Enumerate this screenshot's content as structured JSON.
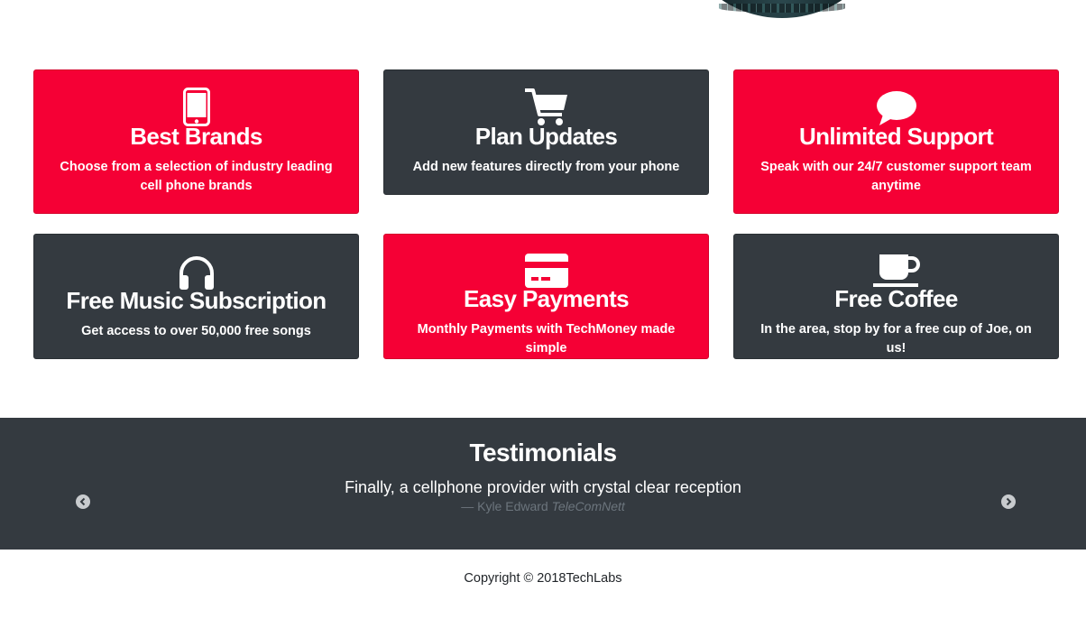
{
  "features": [
    {
      "title": "Best Brands",
      "desc": "Choose from a selection of industry leading cell phone brands",
      "icon": "mobile-phone-icon",
      "color": "#f50035"
    },
    {
      "title": "Plan Updates",
      "desc": "Add new features directly from your phone",
      "icon": "shopping-cart-icon",
      "color": "#343a40"
    },
    {
      "title": "Unlimited Support",
      "desc": "Speak with our 24/7 customer support team anytime",
      "icon": "comment-icon",
      "color": "#f50035"
    },
    {
      "title": "Free Music Subscription",
      "desc": "Get access to over 50,000 free songs",
      "icon": "headphones-icon",
      "color": "#343a40"
    },
    {
      "title": "Easy Payments",
      "desc": "Monthly Payments with TechMoney made simple",
      "icon": "credit-card-icon",
      "color": "#f50035"
    },
    {
      "title": "Free Coffee",
      "desc": "In the area, stop by for a free cup of Joe, on us!",
      "icon": "coffee-icon",
      "color": "#343a40"
    }
  ],
  "testimonials": {
    "heading": "Testimonials",
    "quote": "Finally, a cellphone provider with crystal clear reception",
    "author": "— Kyle Edward",
    "company": "TeleComNett",
    "prev_icon": "chevron-left-circle-icon",
    "next_icon": "chevron-right-circle-icon"
  },
  "footer": {
    "copyright": "Copyright © 2018TechLabs"
  }
}
